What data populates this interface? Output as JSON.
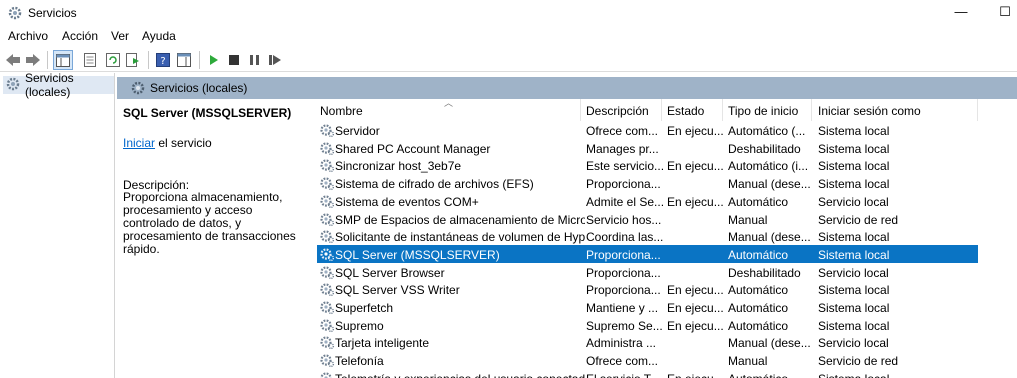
{
  "window": {
    "title": "Servicios",
    "minimize": "—",
    "maximize": "☐"
  },
  "menu": [
    "Archivo",
    "Acción",
    "Ver",
    "Ayuda"
  ],
  "tree": {
    "item": "Servicios (locales)"
  },
  "content_header": "Servicios (locales)",
  "details": {
    "service_title": "SQL Server (MSSQLSERVER)",
    "start_link": "Iniciar",
    "start_suffix": " el servicio",
    "description_label": "Descripción:",
    "description_text": "Proporciona almacenamiento, procesamiento y acceso controlado de datos, y procesamiento de transacciones rápido."
  },
  "list": {
    "columns": [
      "Nombre",
      "Descripción",
      "Estado",
      "Tipo de inicio",
      "Iniciar sesión como"
    ],
    "rows": [
      {
        "name": "Servidor",
        "desc": "Ofrece com...",
        "state": "En ejecu...",
        "start": "Automático (...",
        "logon": "Sistema local"
      },
      {
        "name": "Shared PC Account Manager",
        "desc": "Manages pr...",
        "state": "",
        "start": "Deshabilitado",
        "logon": "Sistema local"
      },
      {
        "name": "Sincronizar host_3eb7e",
        "desc": "Este servicio...",
        "state": "En ejecu...",
        "start": "Automático (i...",
        "logon": "Sistema local"
      },
      {
        "name": "Sistema de cifrado de archivos (EFS)",
        "desc": "Proporciona...",
        "state": "",
        "start": "Manual (dese...",
        "logon": "Sistema local"
      },
      {
        "name": "Sistema de eventos COM+",
        "desc": "Admite el Se...",
        "state": "En ejecu...",
        "start": "Automático",
        "logon": "Servicio local"
      },
      {
        "name": "SMP de Espacios de almacenamiento de Micros",
        "desc": "Servicio hos...",
        "state": "",
        "start": "Manual",
        "logon": "Servicio de red"
      },
      {
        "name": "Solicitante de instantáneas de volumen de Hype",
        "desc": "Coordina las...",
        "state": "",
        "start": "Manual (dese...",
        "logon": "Sistema local"
      },
      {
        "name": "SQL Server (MSSQLSERVER)",
        "desc": "Proporciona...",
        "state": "",
        "start": "Automático",
        "logon": "Sistema local"
      },
      {
        "name": "SQL Server Browser",
        "desc": "Proporciona...",
        "state": "",
        "start": "Deshabilitado",
        "logon": "Servicio local"
      },
      {
        "name": "SQL Server VSS Writer",
        "desc": "Proporciona...",
        "state": "En ejecu...",
        "start": "Automático",
        "logon": "Sistema local"
      },
      {
        "name": "Superfetch",
        "desc": "Mantiene y ...",
        "state": "En ejecu...",
        "start": "Automático",
        "logon": "Sistema local"
      },
      {
        "name": "Supremo",
        "desc": "Supremo Se...",
        "state": "En ejecu...",
        "start": "Automático",
        "logon": "Sistema local"
      },
      {
        "name": "Tarjeta inteligente",
        "desc": "Administra ...",
        "state": "",
        "start": "Manual (dese...",
        "logon": "Servicio local"
      },
      {
        "name": "Telefonía",
        "desc": "Ofrece com...",
        "state": "",
        "start": "Manual",
        "logon": "Servicio de red"
      },
      {
        "name": "Telemetría y experiencias del usuario conectado",
        "desc": "El servicio T...",
        "state": "En ejecu...",
        "start": "Automático",
        "logon": "Sistema local"
      }
    ],
    "selected_index": 7
  },
  "colors": {
    "selection": "#0a74c4",
    "header_band": "#9fb3c8",
    "link": "#0066cc"
  }
}
